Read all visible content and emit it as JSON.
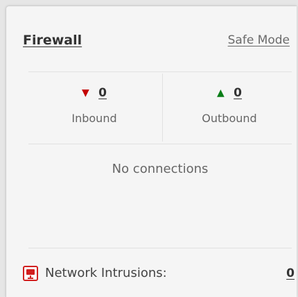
{
  "firewall": {
    "title": "Firewall",
    "safe_mode_label": "Safe Mode"
  },
  "stats": {
    "inbound": {
      "count": "0",
      "label": "Inbound",
      "icon": "red-down-triangle"
    },
    "outbound": {
      "count": "0",
      "label": "Outbound",
      "icon": "green-up-triangle"
    }
  },
  "connections": {
    "empty_message": "No connections"
  },
  "intrusions": {
    "label": "Network Intrusions:",
    "count": "0",
    "icon": "monitor-icon"
  },
  "colors": {
    "inbound_arrow": "#c40000",
    "outbound_arrow": "#0a7d18",
    "intrusion_icon": "#d11f1f"
  }
}
